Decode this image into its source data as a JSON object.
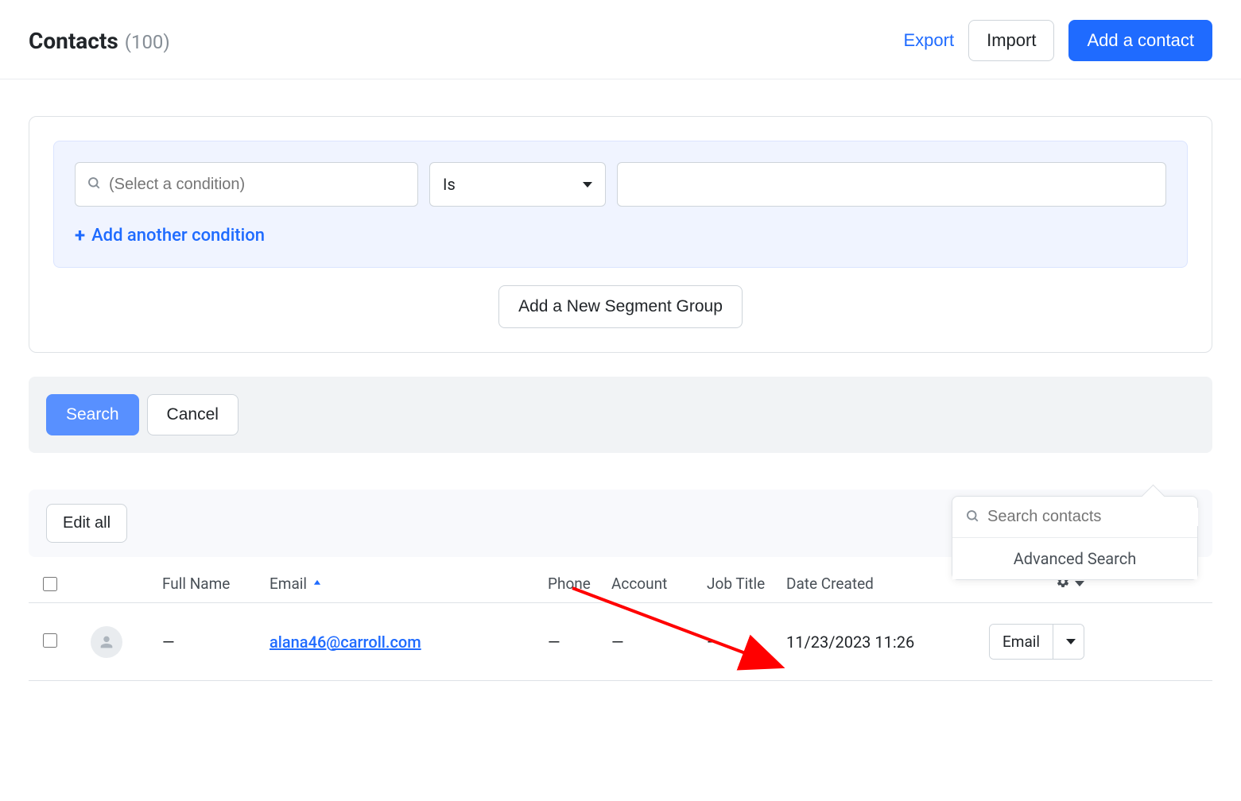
{
  "header": {
    "title": "Contacts",
    "count": "(100)",
    "export": "Export",
    "import": "Import",
    "add": "Add a contact"
  },
  "segment": {
    "condition_placeholder": "(Select a condition)",
    "operator": "Is",
    "add_condition": "Add another condition",
    "add_group": "Add a New Segment Group"
  },
  "actions": {
    "search": "Search",
    "cancel": "Cancel"
  },
  "list_header": {
    "edit_all": "Edit all"
  },
  "search_popover": {
    "placeholder": "Search contacts",
    "advanced": "Advanced Search"
  },
  "columns": {
    "full_name": "Full Name",
    "email": "Email",
    "phone": "Phone",
    "account": "Account",
    "job_title": "Job Title",
    "date_created": "Date Created"
  },
  "rows": [
    {
      "full_name": "—",
      "email": "alana46@carroll.com",
      "phone": "—",
      "account": "—",
      "job_title": "—",
      "date_created": "11/23/2023 11:26",
      "action": "Email"
    }
  ]
}
